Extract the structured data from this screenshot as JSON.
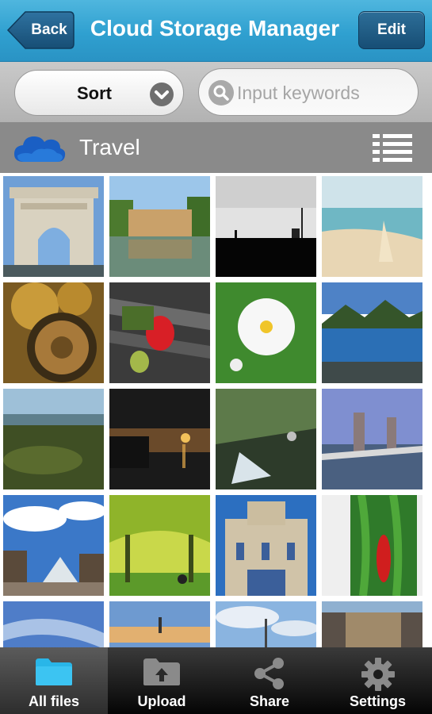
{
  "header": {
    "back_label": "Back",
    "title": "Cloud Storage Manager",
    "edit_label": "Edit"
  },
  "search": {
    "sort_label": "Sort",
    "placeholder": "Input keywords"
  },
  "folder": {
    "name": "Travel",
    "icon": "cloud-icon"
  },
  "tabs": [
    {
      "label": "All files",
      "icon": "folder-icon",
      "active": true
    },
    {
      "label": "Upload",
      "icon": "upload-icon",
      "active": false
    },
    {
      "label": "Share",
      "icon": "share-icon",
      "active": false
    },
    {
      "label": "Settings",
      "icon": "gear-icon",
      "active": false
    }
  ],
  "colors": {
    "header": "#2fa0d0",
    "edit_button": "#1f5b86",
    "folder_bar": "#8a8a8a",
    "tab_active_icon": "#29b6e8"
  }
}
